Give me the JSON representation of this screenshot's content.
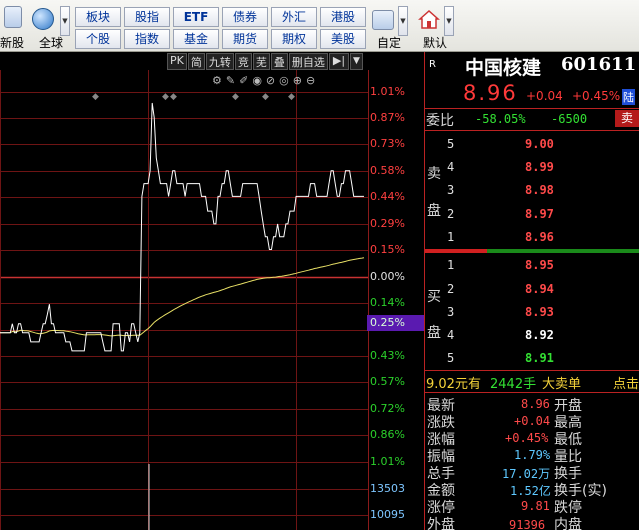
{
  "toolbar": {
    "new_stock": "新股",
    "global": "全球",
    "custom": "自定",
    "default": "默认",
    "row1": [
      "板块",
      "股指",
      "ETF",
      "债券",
      "外汇",
      "港股"
    ],
    "row2": [
      "个股",
      "指数",
      "基金",
      "期货",
      "期权",
      "美股"
    ]
  },
  "chart_toolbar": [
    "PK",
    "简",
    "九转",
    "竞",
    "芜",
    "叠",
    "删自选"
  ],
  "price_axis": {
    "upper": [
      "1.01%",
      "0.87%",
      "0.73%",
      "0.58%",
      "0.44%",
      "0.29%",
      "0.15%"
    ],
    "zero": "0.00%",
    "lower": [
      "0.14%",
      "0.25%",
      "0.43%",
      "0.57%",
      "0.72%",
      "0.86%",
      "1.01%"
    ]
  },
  "volume_axis": [
    "13503",
    "10095"
  ],
  "quote": {
    "market_tag": "R",
    "name": "中国核建",
    "code": "601611",
    "price": "8.96",
    "change": "+0.04",
    "change_pct": "+0.45%",
    "exchange_tag": "陆",
    "weibi_label": "委比",
    "weibi_pct": "-58.05%",
    "weibi_diff": "-6500",
    "sell_tag": "卖",
    "sell_side": [
      "卖",
      "盘"
    ],
    "buy_side": [
      "买",
      "盘"
    ],
    "asks": [
      {
        "level": "5",
        "price": "9.00"
      },
      {
        "level": "4",
        "price": "8.99"
      },
      {
        "level": "3",
        "price": "8.98"
      },
      {
        "level": "2",
        "price": "8.97"
      },
      {
        "level": "1",
        "price": "8.96"
      }
    ],
    "bids": [
      {
        "level": "1",
        "price": "8.95"
      },
      {
        "level": "2",
        "price": "8.94"
      },
      {
        "level": "3",
        "price": "8.93"
      },
      {
        "level": "4",
        "price": "8.92"
      },
      {
        "level": "5",
        "price": "8.91"
      }
    ],
    "big_order_price": "9.02元有",
    "big_order_vol": "2442手",
    "big_order_text": "大卖单",
    "big_order_action": "点击",
    "stats": [
      {
        "label": "最新",
        "value": "8.96",
        "label2": "开盘"
      },
      {
        "label": "涨跌",
        "value": "+0.04",
        "label2": "最高"
      },
      {
        "label": "涨幅",
        "value": "+0.45%",
        "label2": "最低"
      },
      {
        "label": "振幅",
        "value": "1.79%",
        "label2": "量比"
      },
      {
        "label": "总手",
        "value": "17.02万",
        "label2": "换手"
      },
      {
        "label": "金额",
        "value": "1.52亿",
        "label2": "换手(实)"
      },
      {
        "label": "涨停",
        "value": "9.81",
        "label2": "跌停"
      },
      {
        "label": "外盘",
        "value": "91396",
        "label2": "内盘"
      }
    ]
  },
  "chart_data": {
    "type": "line",
    "title": "",
    "xlabel": "",
    "ylabel": "",
    "ylim_pct": [
      -1.01,
      1.01
    ],
    "series": [
      {
        "values": [
          -0.43,
          -0.43,
          -0.43,
          -0.43,
          -0.43,
          -0.43,
          -0.36,
          -0.43,
          -0.43,
          -0.36,
          -0.36,
          -0.43,
          -0.43,
          -0.43,
          -0.43,
          -0.5,
          -0.5,
          -0.5,
          -0.5,
          -0.5,
          -0.43,
          -0.36,
          -0.36,
          -0.29,
          -0.21,
          -0.36,
          -0.36,
          -0.43,
          -0.43,
          -0.43,
          -0.43,
          -0.43,
          -0.5,
          -0.5,
          -0.5,
          -0.57,
          -0.57,
          -0.57,
          -0.57,
          -0.57,
          -0.57,
          -0.57,
          -0.43,
          -0.43,
          -0.43,
          -0.43,
          -0.43,
          -0.43,
          -0.43,
          -0.43,
          -0.5,
          -0.57,
          -0.57,
          -0.57,
          -0.57,
          -0.36,
          -0.36,
          -0.36,
          -0.36,
          -0.57,
          -0.57,
          -0.43,
          -0.43,
          -0.5,
          -0.36,
          -0.36,
          -0.43,
          -0.5,
          -0.43,
          0.44,
          0.51,
          0.51,
          0.51,
          0.58,
          0.95,
          0.87,
          0.65,
          0.58,
          0.51,
          0.51,
          0.51,
          0.51,
          0.44,
          0.51,
          0.58,
          0.58,
          0.51,
          0.51,
          0.51,
          0.51,
          0.44,
          0.51,
          0.51,
          0.51,
          0.51,
          0.51,
          0.51,
          0.51,
          0.44,
          0.44,
          0.44,
          0.36,
          0.36,
          0.36,
          0.29,
          0.29,
          0.44,
          0.44,
          0.51,
          0.51,
          0.58,
          0.58,
          0.51,
          0.44,
          0.44,
          0.44,
          0.44,
          0.44,
          0.51,
          0.51,
          0.51,
          0.51,
          0.51,
          0.51,
          0.51,
          0.51,
          0.44,
          0.36,
          0.29,
          0.22,
          0.22,
          0.15,
          0.15,
          0.22,
          0.22,
          0.29,
          0.22,
          0.22,
          0.22,
          0.29,
          0.29,
          0.36,
          0.36,
          0.36,
          0.44,
          0.44,
          0.44,
          0.44,
          0.44,
          0.44,
          0.44,
          0.51,
          0.51,
          0.51,
          0.44,
          0.44,
          0.44,
          0.44,
          0.44,
          0.44,
          0.51,
          0.58,
          0.58,
          0.51,
          0.44,
          0.44,
          0.51,
          0.51,
          0.58,
          0.58,
          0.58,
          0.51,
          0.44,
          0.44,
          0.44,
          0.44,
          0.44,
          0.44
        ]
      }
    ]
  }
}
